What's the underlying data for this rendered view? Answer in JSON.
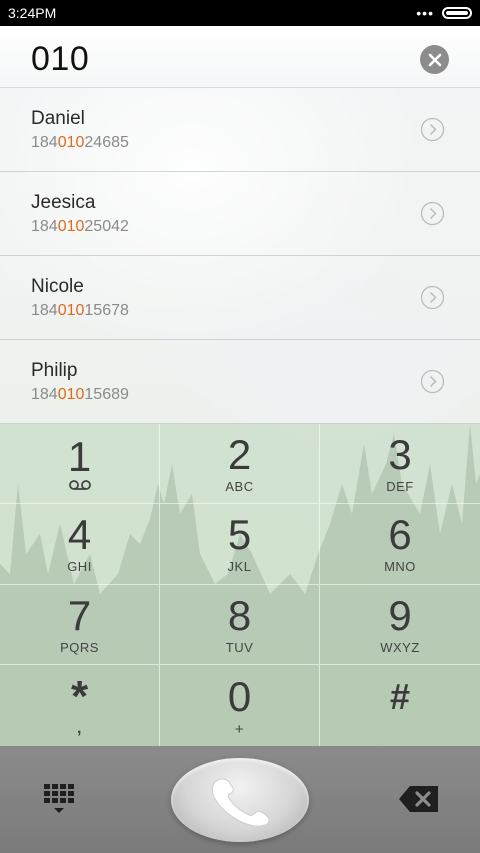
{
  "status_bar": {
    "time": "3:24PM",
    "dots": "•••"
  },
  "dialer": {
    "number": "010"
  },
  "contacts": [
    {
      "name": "Daniel",
      "number_pre": "184",
      "number_match": "010",
      "number_post": "24685"
    },
    {
      "name": "Jeesica",
      "number_pre": "184",
      "number_match": "010",
      "number_post": "25042"
    },
    {
      "name": "Nicole",
      "number_pre": "184",
      "number_match": "010",
      "number_post": "15678"
    },
    {
      "name": "Philip",
      "number_pre": "184",
      "number_match": "010",
      "number_post": "15689"
    }
  ],
  "keypad": [
    {
      "digit": "1",
      "letters": "",
      "sub_icon": "voicemail-icon"
    },
    {
      "digit": "2",
      "letters": "ABC"
    },
    {
      "digit": "3",
      "letters": "DEF"
    },
    {
      "digit": "4",
      "letters": "GHI"
    },
    {
      "digit": "5",
      "letters": "JKL"
    },
    {
      "digit": "6",
      "letters": "MNO"
    },
    {
      "digit": "7",
      "letters": "PQRS"
    },
    {
      "digit": "8",
      "letters": "TUV"
    },
    {
      "digit": "9",
      "letters": "WXYZ"
    },
    {
      "digit": "*",
      "letters": ","
    },
    {
      "digit": "0",
      "letters": "+"
    },
    {
      "digit": "#",
      "letters": ""
    }
  ],
  "colors": {
    "match_highlight": "#e06a1b",
    "dialpad_tint": "#cee0cd",
    "bottom_bar": "#808180"
  },
  "icons": {
    "clear": "clear-icon",
    "chevron": "chevron-right-circle-icon",
    "keypad_toggle": "dialpad-icon",
    "call": "phone-handset-icon",
    "backspace": "backspace-icon"
  }
}
